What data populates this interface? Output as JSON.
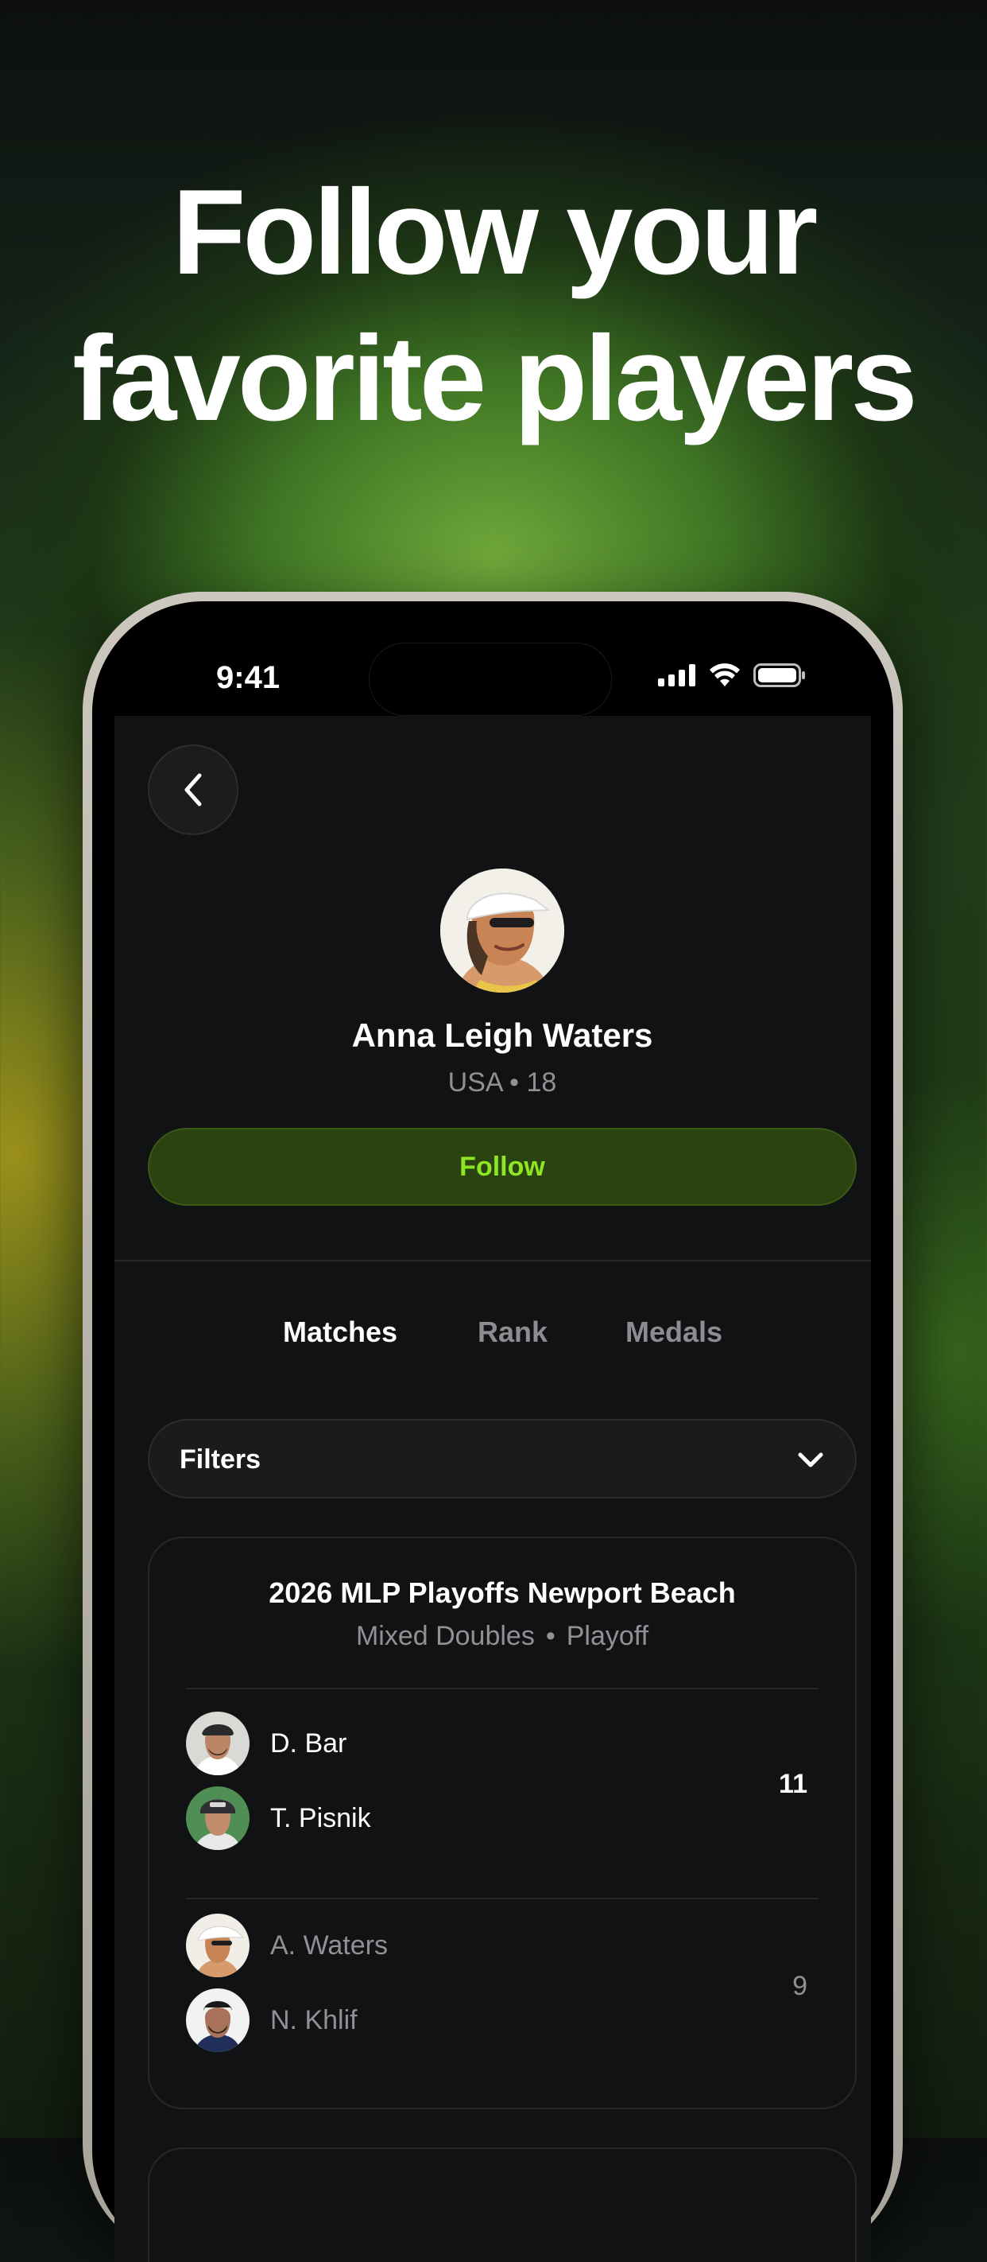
{
  "headline": {
    "line1": "Follow your",
    "line2": "favorite players"
  },
  "status_bar": {
    "time": "9:41"
  },
  "profile": {
    "name": "Anna Leigh Waters",
    "meta": "USA • 18",
    "follow_label": "Follow"
  },
  "tabs": [
    {
      "label": "Matches",
      "active": true
    },
    {
      "label": "Rank",
      "active": false
    },
    {
      "label": "Medals",
      "active": false
    }
  ],
  "filters": {
    "label": "Filters"
  },
  "match": {
    "event": "2026 MLP Playoffs Newport Beach",
    "category": "Mixed Doubles",
    "round": "Playoff",
    "separator": "•",
    "teams": [
      {
        "players": [
          "D. Bar",
          "T. Pisnik"
        ],
        "score": "11",
        "winner": true
      },
      {
        "players": [
          "A. Waters",
          "N. Khlif"
        ],
        "score": "9",
        "winner": false
      }
    ]
  },
  "colors": {
    "accent_green": "#8ee521",
    "follow_bg": "#2b4311",
    "screen_bg": "#111213",
    "muted_text": "#8f9194"
  },
  "icons": [
    "back-chevron-icon",
    "chevron-down-icon",
    "signal-icon",
    "wifi-icon",
    "battery-icon"
  ]
}
